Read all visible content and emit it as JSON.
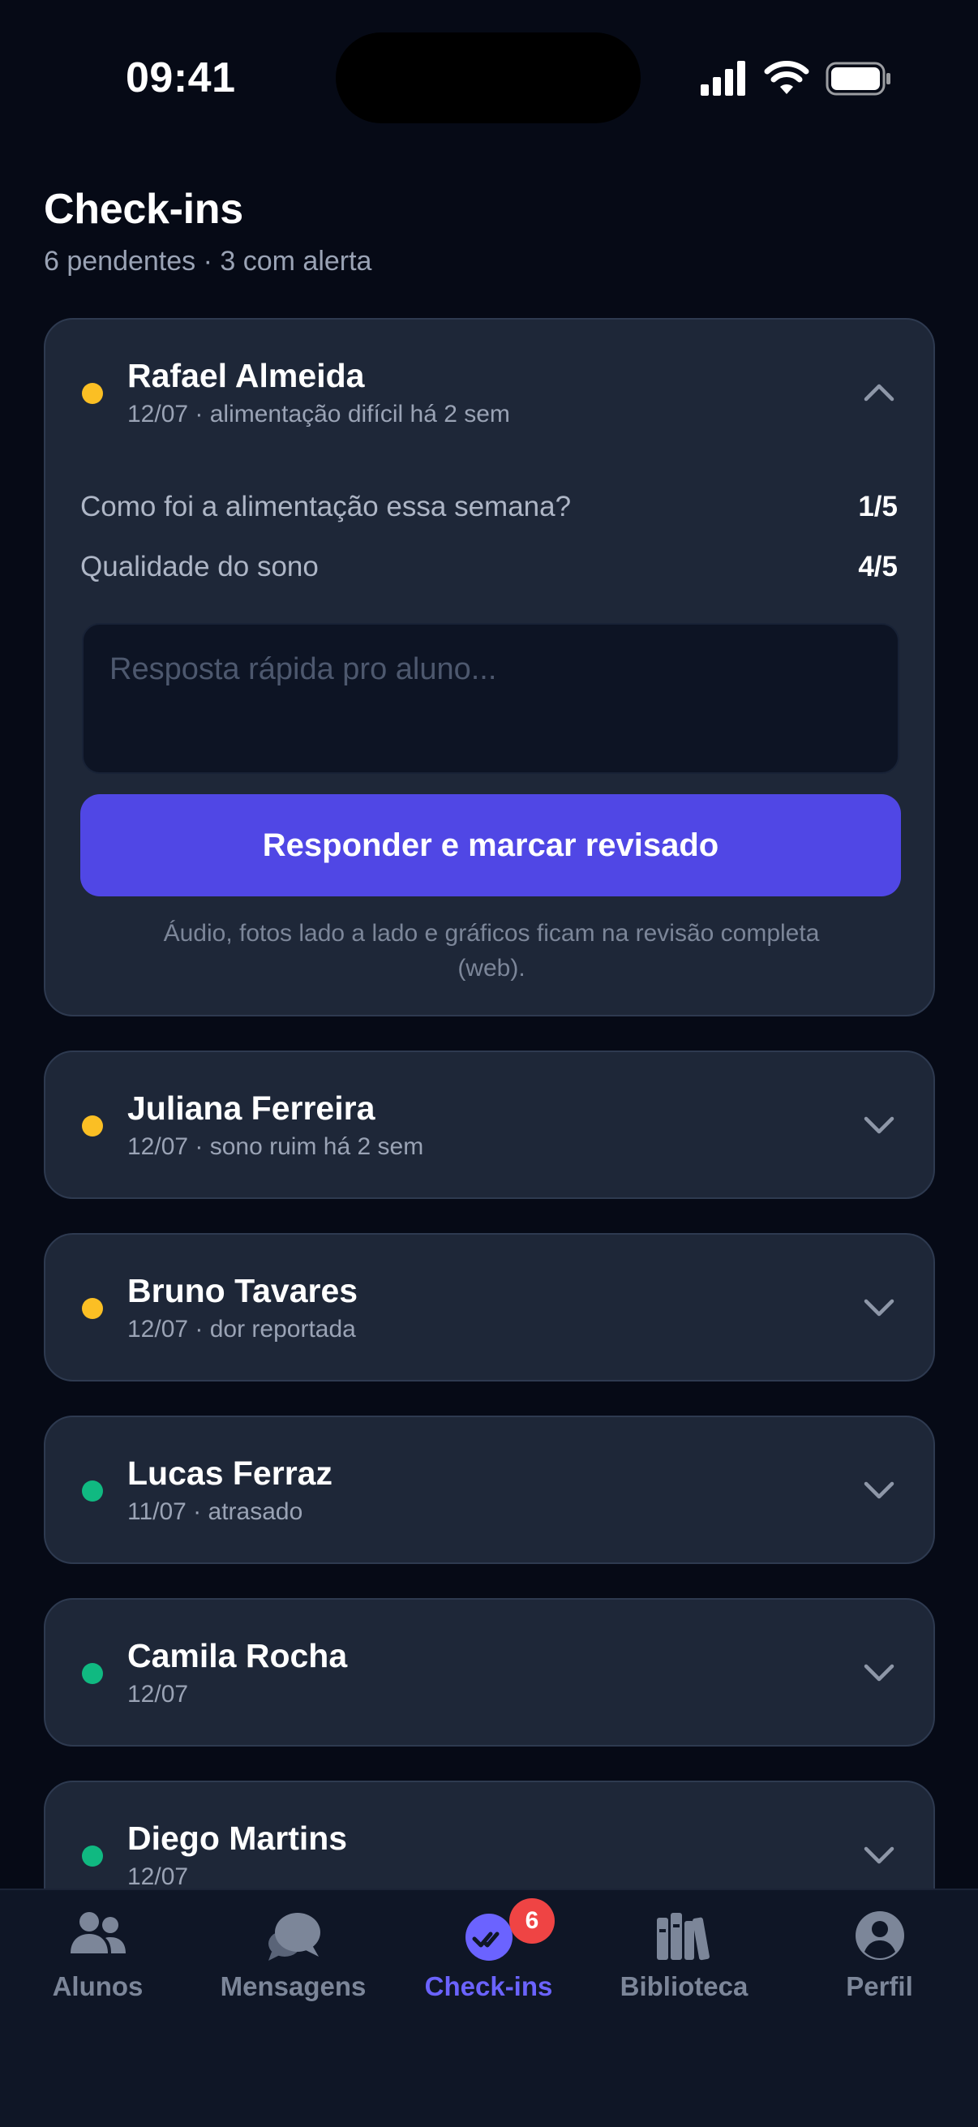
{
  "status_bar": {
    "time": "09:41"
  },
  "header": {
    "title": "Check-ins",
    "subtitle": "6 pendentes · 3 com alerta"
  },
  "checkins": [
    {
      "name": "Rafael Almeida",
      "meta": "12/07 · alimentação difícil há 2 sem",
      "status": "alert",
      "expanded": true,
      "questions": [
        {
          "label": "Como foi a alimentação essa semana?",
          "value": "1/5"
        },
        {
          "label": "Qualidade do sono",
          "value": "4/5"
        }
      ],
      "reply_placeholder": "Resposta rápida pro aluno...",
      "reply_button": "Responder e marcar revisado",
      "footnote": "Áudio, fotos lado a lado e gráficos ficam na revisão completa (web)."
    },
    {
      "name": "Juliana Ferreira",
      "meta": "12/07 · sono ruim há 2 sem",
      "status": "alert",
      "expanded": false
    },
    {
      "name": "Bruno Tavares",
      "meta": "12/07 · dor reportada",
      "status": "alert",
      "expanded": false
    },
    {
      "name": "Lucas Ferraz",
      "meta": "11/07 · atrasado",
      "status": "ok",
      "expanded": false
    },
    {
      "name": "Camila Rocha",
      "meta": "12/07",
      "status": "ok",
      "expanded": false
    },
    {
      "name": "Diego Martins",
      "meta": "12/07",
      "status": "ok",
      "expanded": false
    }
  ],
  "tabbar": {
    "tabs": [
      {
        "label": "Alunos",
        "icon": "users-icon"
      },
      {
        "label": "Mensagens",
        "icon": "chat-bubbles-icon"
      },
      {
        "label": "Check-ins",
        "icon": "checkins-icon",
        "badge": "6",
        "active": true
      },
      {
        "label": "Biblioteca",
        "icon": "library-icon"
      },
      {
        "label": "Perfil",
        "icon": "profile-icon"
      }
    ]
  },
  "colors": {
    "background": "#060a16",
    "card": "#1e2738",
    "accent": "#5047e5",
    "alert_dot": "#fbbf24",
    "ok_dot": "#10b981",
    "badge": "#ef4444"
  }
}
